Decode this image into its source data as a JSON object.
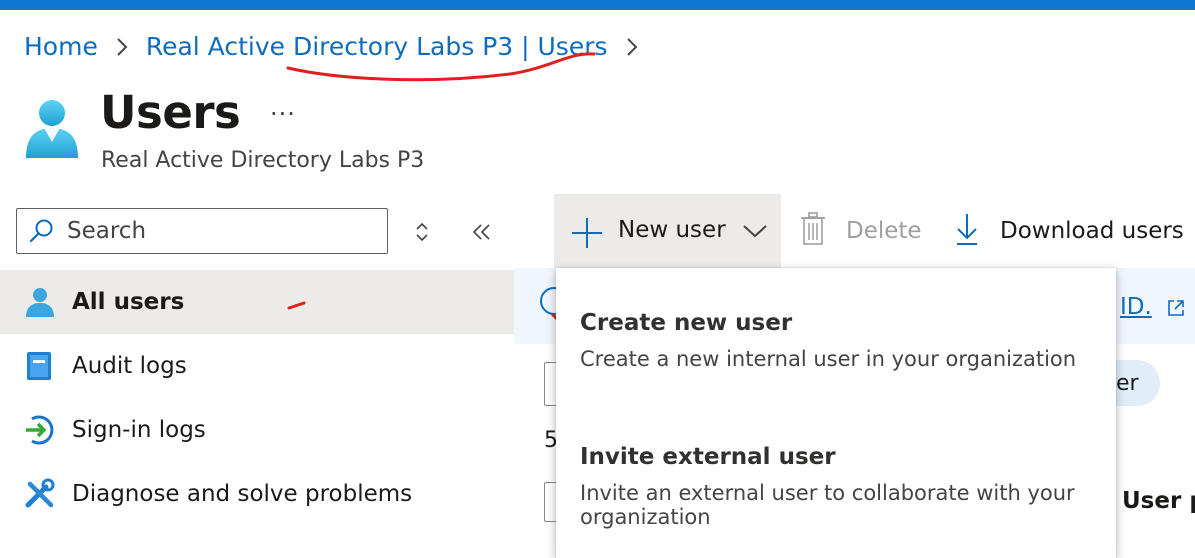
{
  "breadcrumb": {
    "home": "Home",
    "tenant_users": "Real Active Directory Labs P3 | Users"
  },
  "header": {
    "title": "Users",
    "more": "···",
    "subtitle": "Real Active Directory Labs P3"
  },
  "sidebar": {
    "search_placeholder": "Search",
    "items": [
      {
        "label": "All users",
        "icon": "user-icon",
        "selected": true
      },
      {
        "label": "Audit logs",
        "icon": "book-icon"
      },
      {
        "label": "Sign-in logs",
        "icon": "sign-in-icon"
      },
      {
        "label": "Diagnose and solve problems",
        "icon": "wrench-icon"
      }
    ]
  },
  "toolbar": {
    "new_user": "New user",
    "delete": "Delete",
    "download": "Download users"
  },
  "new_user_menu": {
    "options": [
      {
        "title": "Create new user",
        "description": "Create a new internal user in your organization"
      },
      {
        "title": "Invite external user",
        "description": "Invite an external user to collaborate with your organization"
      }
    ]
  },
  "background": {
    "info_link_fragment": "ID.",
    "count_fragment": "5",
    "pill_fragment": "er",
    "column_header_fragment": "User p"
  },
  "colors": {
    "accent": "#0f78d4",
    "link": "#0f6cbd",
    "selected_bg": "#edebe9",
    "annotation": "#e01f1f"
  }
}
